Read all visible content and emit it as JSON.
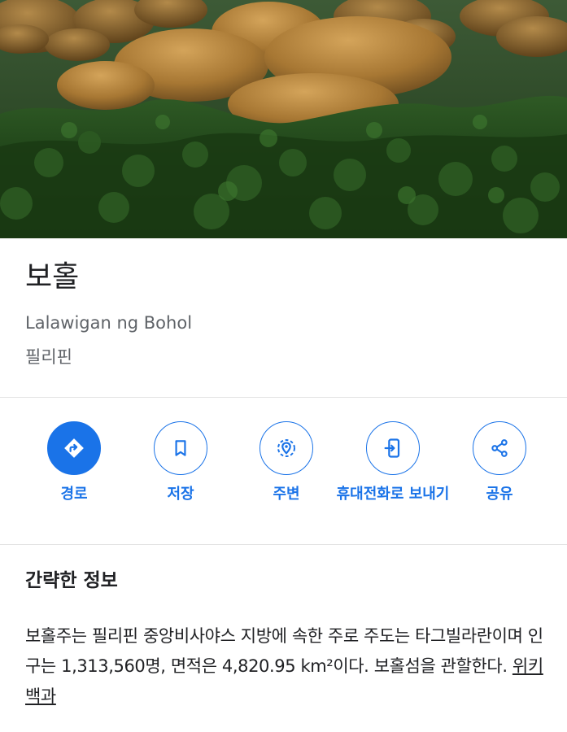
{
  "place": {
    "title": "보홀",
    "subtitle": "Lalawigan ng Bohol",
    "country": "필리핀"
  },
  "actions": [
    {
      "label": "경로",
      "icon": "directions-icon"
    },
    {
      "label": "저장",
      "icon": "bookmark-icon"
    },
    {
      "label": "주변",
      "icon": "nearby-icon"
    },
    {
      "label": "휴대전화로 보내기",
      "icon": "send-to-phone-icon"
    },
    {
      "label": "공유",
      "icon": "share-icon"
    }
  ],
  "summary": {
    "heading": "간략한 정보",
    "text": "보홀주는 필리핀 중앙비사야스 지방에 속한 주로 주도는 타그빌라란이며 인구는 1,313,560명, 면적은 4,820.95 km²이다. 보홀섬을 관할한다. ",
    "source_link": "위키백과"
  },
  "colors": {
    "accent": "#1a73e8",
    "text_primary": "#202124",
    "text_secondary": "#5f6368"
  }
}
